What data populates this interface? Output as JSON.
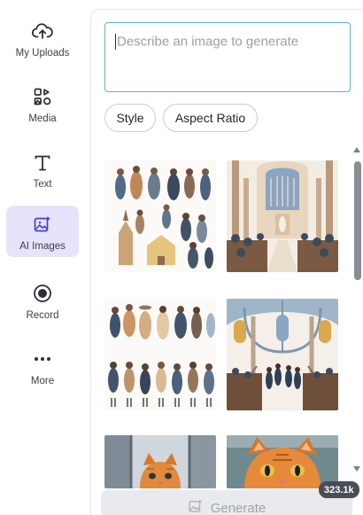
{
  "sidebar": {
    "items": [
      {
        "label": "My Uploads",
        "icon": "cloud-upload-icon",
        "active": false
      },
      {
        "label": "Media",
        "icon": "media-grid-icon",
        "active": false
      },
      {
        "label": "Text",
        "icon": "text-t-icon",
        "active": false
      },
      {
        "label": "AI Images",
        "icon": "ai-image-sparkle-icon",
        "active": true
      },
      {
        "label": "Record",
        "icon": "record-icon",
        "active": false
      },
      {
        "label": "More",
        "icon": "more-dots-icon",
        "active": false
      }
    ]
  },
  "prompt": {
    "placeholder": "Describe an image to generate"
  },
  "options": {
    "style_label": "Style",
    "aspect_label": "Aspect Ratio"
  },
  "gallery": [
    {
      "name": "watercolor-congregation-collage",
      "description": "watercolor people and churches"
    },
    {
      "name": "watercolor-church-interior",
      "description": "church interior with pews"
    },
    {
      "name": "watercolor-crowd-figures",
      "description": "crowd of people"
    },
    {
      "name": "watercolor-cathedral-nave",
      "description": "cathedral nave"
    },
    {
      "name": "orange-cat-window",
      "description": "orange cat by window"
    },
    {
      "name": "orange-cat-closeup",
      "description": "orange cat closeup"
    }
  ],
  "generate": {
    "label": "Generate"
  },
  "badge": {
    "count": "323.1k"
  },
  "colors": {
    "accent_border": "#5eb3c6",
    "active_bg": "#e6e4fb",
    "ai_icon": "#4b3fc9"
  }
}
